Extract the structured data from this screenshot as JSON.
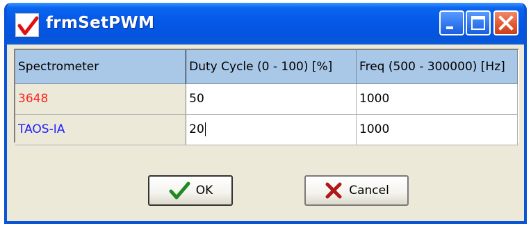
{
  "window": {
    "title": "frmSetPWM",
    "controls": {
      "minimize": "minimize-icon",
      "maximize": "maximize-icon",
      "close": "close-icon"
    }
  },
  "grid": {
    "headers": [
      "Spectrometer",
      "Duty Cycle (0 - 100) [%]",
      "Freq (500 - 300000) [Hz]"
    ],
    "rows": [
      {
        "spectrometer": "3648",
        "duty_cycle": "50",
        "freq": "1000",
        "name_color": "#ff2020"
      },
      {
        "spectrometer": "TAOS-IA",
        "duty_cycle": "20",
        "freq": "1000",
        "name_color": "#2020ff"
      }
    ],
    "header_color": "#a9c8e8"
  },
  "buttons": {
    "ok_label": "OK",
    "cancel_label": "Cancel",
    "ok_icon": "checkmark-icon",
    "cancel_icon": "x-mark-icon"
  },
  "colors": {
    "titlebar": "#0558e6",
    "window_bg": "#ece9d8"
  }
}
